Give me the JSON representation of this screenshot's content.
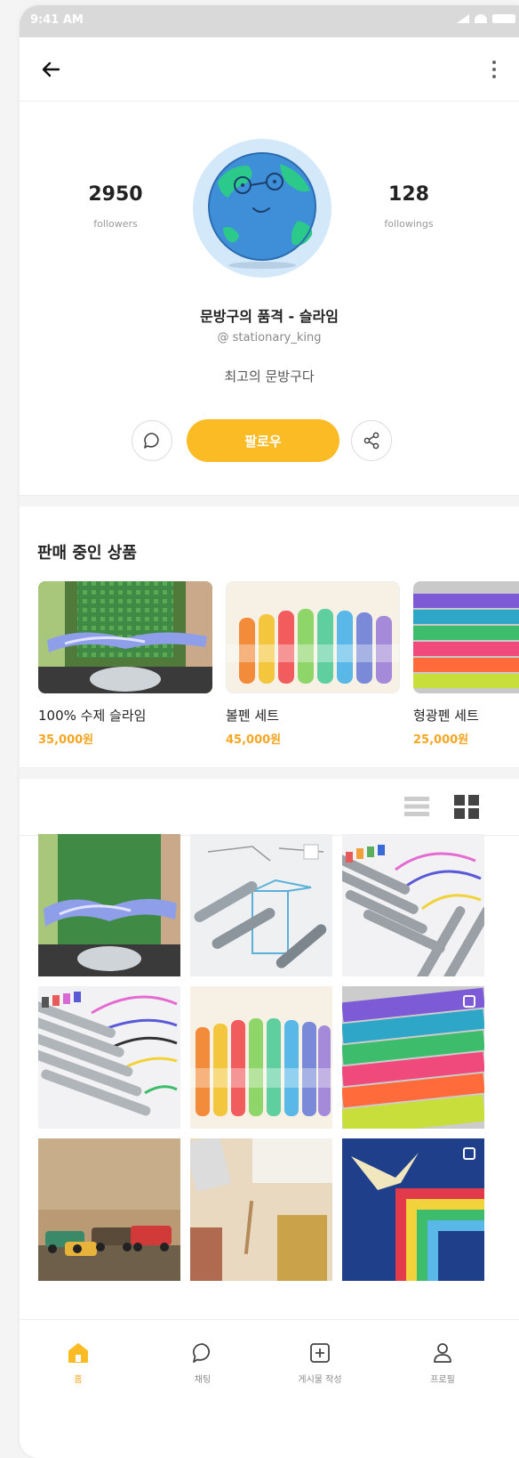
{
  "status_bar": {
    "time": "9:41 AM"
  },
  "profile": {
    "followers_count": "2950",
    "followers_label": "followers",
    "followings_count": "128",
    "followings_label": "followings",
    "display_name": "문방구의 품격 - 슬라임",
    "handle": "@ stationary_king",
    "bio": "최고의 문방구다",
    "follow_label": "팔로우"
  },
  "products_section": {
    "title": "판매 중인 상품",
    "items": [
      {
        "name": "100% 수제 슬라임",
        "price": "35,000원"
      },
      {
        "name": "볼펜 세트",
        "price": "45,000원"
      },
      {
        "name": "형광펜 세트",
        "price": "25,000원"
      }
    ]
  },
  "bottom_nav": {
    "items": [
      {
        "label": "홈"
      },
      {
        "label": "채팅"
      },
      {
        "label": "게시물 작성"
      },
      {
        "label": "프로필"
      }
    ]
  },
  "colors": {
    "accent": "#fbbb24",
    "price": "#f5a623",
    "muted_text": "#888888"
  },
  "icons": [
    "back-arrow-icon",
    "more-vertical-icon",
    "chat-bubble-icon",
    "share-icon",
    "list-view-icon",
    "grid-view-icon",
    "multi-photo-icon",
    "home-icon",
    "plus-square-icon",
    "user-icon"
  ]
}
